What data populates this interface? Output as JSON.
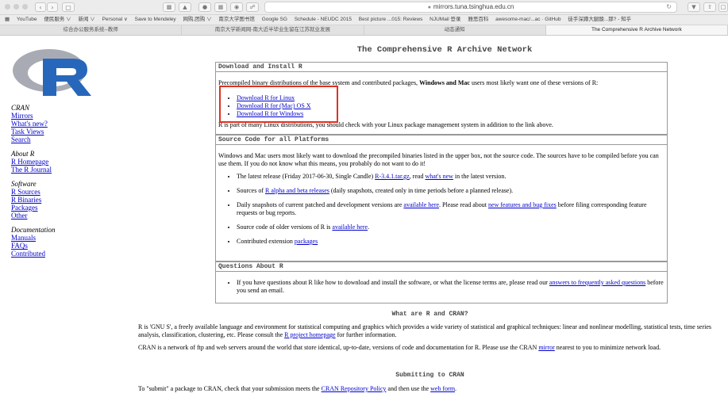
{
  "browser": {
    "url": "mirrors.tuna.tsinghua.edu.cn",
    "bookmarks": [
      "YouTube",
      "便民服务 ∨",
      "新闻 ∨",
      "Personal ∨",
      "Save to Mendeley",
      "网购,团购 ∨",
      "南京大学图书馆",
      "Google SG",
      "Schedule - NEUDC 2015",
      "Best picture ...015: Reviews",
      "NJUMail 登录",
      "雅思百科",
      "awesome-mac/...ac · GitHub",
      "徒手深蹲大腿酸...那? - 知乎"
    ],
    "tabs": [
      "综合办公服务系统--教师",
      "南京大学新闻网-南大近半毕业生留在江苏就业发展",
      "动态通知",
      "The Comprehensive R Archive Network"
    ]
  },
  "page": {
    "title": "The Comprehensive R Archive Network"
  },
  "sidebar": {
    "cran_heading": "CRAN",
    "cran_links": [
      "Mirrors",
      "What's new?",
      "Task Views",
      "Search"
    ],
    "about_heading": "About R",
    "about_links": [
      "R Homepage",
      "The R Journal"
    ],
    "software_heading": "Software",
    "software_links": [
      "R Sources",
      "R Binaries",
      "Packages",
      "Other"
    ],
    "doc_heading": "Documentation",
    "doc_links": [
      "Manuals",
      "FAQs",
      "Contributed"
    ]
  },
  "download_box": {
    "heading": "Download and Install R",
    "intro_pre": "Precompiled binary distributions of the base system and contributed packages, ",
    "intro_bold": "Windows and Mac",
    "intro_post": " users most likely want one of these versions of R:",
    "links": [
      "Download R for Linux",
      "Download R for (Mac) OS X",
      "Download R for Windows"
    ],
    "note": "R is part of many Linux distributions, you should check with your Linux package management system in addition to the link above."
  },
  "source_box": {
    "heading": "Source Code for all Platforms",
    "intro": "Windows and Mac users most likely want to download the precompiled binaries listed in the upper box, not the source code. The sources have to be compiled before you can use them. If you do not know what this means, you probably do not want to do it!",
    "b1_pre": "The latest release (Friday 2017-06-30, Single Candle) ",
    "b1_link1": "R-3.4.1.tar.gz",
    "b1_mid": ", read ",
    "b1_link2": "what's new",
    "b1_post": " in the latest version.",
    "b2_pre": "Sources of ",
    "b2_link": "R alpha and beta releases",
    "b2_post": " (daily snapshots, created only in time periods before a planned release).",
    "b3_pre": "Daily snapshots of current patched and development versions are ",
    "b3_link1": "available here",
    "b3_mid": ". Please read about ",
    "b3_link2": "new features and bug fixes",
    "b3_post": " before filing corresponding feature requests or bug reports.",
    "b4_pre": "Source code of older versions of R is ",
    "b4_link": "available here",
    "b4_post": ".",
    "b5_pre": "Contributed extension ",
    "b5_link": "packages"
  },
  "questions_box": {
    "heading": "Questions About R",
    "q_pre": "If you have questions about R like how to download and install the software, or what the license terms are, please read our ",
    "q_link": "answers to frequently asked questions",
    "q_post": " before you send an email."
  },
  "what_section": {
    "heading": "What are R and CRAN?",
    "p1_pre": "R is 'GNU S', a freely available language and environment for statistical computing and graphics which provides a wide variety of statistical and graphical techniques: linear and nonlinear modelling, statistical tests, time series analysis, classification, clustering, etc. Please consult the ",
    "p1_link": "R project homepage",
    "p1_post": " for further information.",
    "p2_pre": "CRAN is a network of ftp and web servers around the world that store identical, up-to-date, versions of code and documentation for R. Please use the CRAN ",
    "p2_link": "mirror",
    "p2_post": " nearest to you to minimize network load."
  },
  "submit_section": {
    "heading": "Submitting to CRAN",
    "p_pre": "To \"submit\" a package to CRAN, check that your submission meets the ",
    "p_link1": "CRAN Repository Policy",
    "p_mid": " and then use the ",
    "p_link2": "web form",
    "p_post": "."
  }
}
